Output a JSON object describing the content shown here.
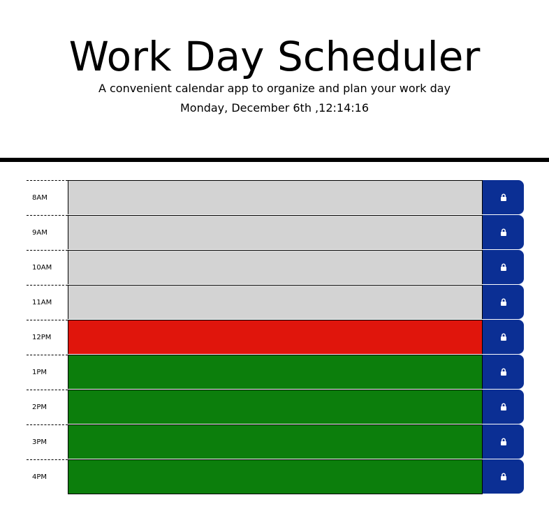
{
  "header": {
    "title": "Work Day Scheduler",
    "subtitle": "A convenient calendar app to organize and plan your work day",
    "current_date": "Monday, December 6th ,12:14:16"
  },
  "colors": {
    "past": "#d3d3d3",
    "present": "#e0150c",
    "future": "#0c7e0c",
    "save_button": "#0b2f94"
  },
  "time_blocks": [
    {
      "hour": "8AM",
      "status": "past",
      "text": "",
      "save_icon": "lock-icon"
    },
    {
      "hour": "9AM",
      "status": "past",
      "text": "",
      "save_icon": "lock-icon"
    },
    {
      "hour": "10AM",
      "status": "past",
      "text": "",
      "save_icon": "lock-icon"
    },
    {
      "hour": "11AM",
      "status": "past",
      "text": "",
      "save_icon": "lock-icon"
    },
    {
      "hour": "12PM",
      "status": "present",
      "text": "",
      "save_icon": "lock-icon"
    },
    {
      "hour": "1PM",
      "status": "future",
      "text": "",
      "save_icon": "lock-icon"
    },
    {
      "hour": "2PM",
      "status": "future",
      "text": "",
      "save_icon": "lock-icon"
    },
    {
      "hour": "3PM",
      "status": "future",
      "text": "",
      "save_icon": "lock-icon"
    },
    {
      "hour": "4PM",
      "status": "future",
      "text": "",
      "save_icon": "lock-icon"
    }
  ]
}
